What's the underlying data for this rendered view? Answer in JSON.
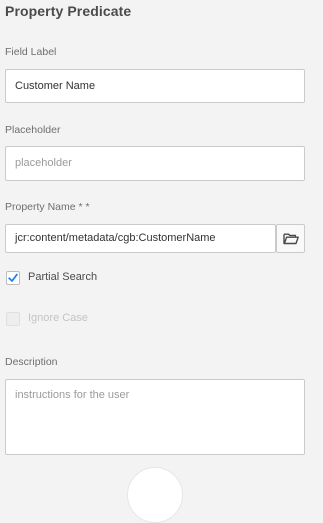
{
  "panel": {
    "title": "Property Predicate"
  },
  "field_label": {
    "label": "Field Label",
    "value": "Customer Name"
  },
  "placeholder_field": {
    "label": "Placeholder",
    "placeholder": "placeholder"
  },
  "property_name": {
    "label": "Property Name * *",
    "value": "jcr:content/metadata/cgb:CustomerName",
    "browse_icon": "folder-open-icon"
  },
  "partial_search": {
    "label": "Partial Search",
    "checked": true
  },
  "ignore_case": {
    "label": "Ignore Case",
    "checked": false,
    "disabled": true
  },
  "description": {
    "label": "Description",
    "placeholder": "instructions for the user"
  },
  "colors": {
    "accent": "#2680eb",
    "background": "#f3f3f3",
    "border": "#cacaca"
  }
}
